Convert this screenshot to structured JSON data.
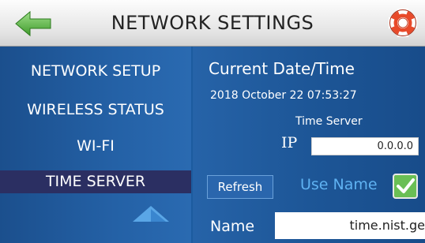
{
  "header": {
    "title": "NETWORK SETTINGS",
    "back_icon": "back-arrow-icon",
    "help_icon": "lifebuoy-icon"
  },
  "sidebar": {
    "items": [
      {
        "label": "NETWORK SETUP"
      },
      {
        "label": "WIRELESS STATUS"
      },
      {
        "label": "WI-FI"
      },
      {
        "label": "TIME SERVER"
      }
    ],
    "active": "TIME SERVER",
    "scroll_up_icon": "scroll-up-arrow-icon"
  },
  "main": {
    "datetime_heading": "Current Date/Time",
    "datetime_value": "2018 October 22 07:53:27",
    "time_server_heading": "Time Server",
    "ip_label": "IP",
    "ip_value": "0.0.0.0",
    "refresh_label": "Refresh",
    "use_name_label": "Use Name",
    "use_name_checked": true,
    "name_label": "Name",
    "name_value": "time.nist.ge"
  },
  "colors": {
    "accent_green": "#6abf55",
    "use_name_text": "#5fb2f2",
    "active_nav_bg": "#2b2f62"
  }
}
